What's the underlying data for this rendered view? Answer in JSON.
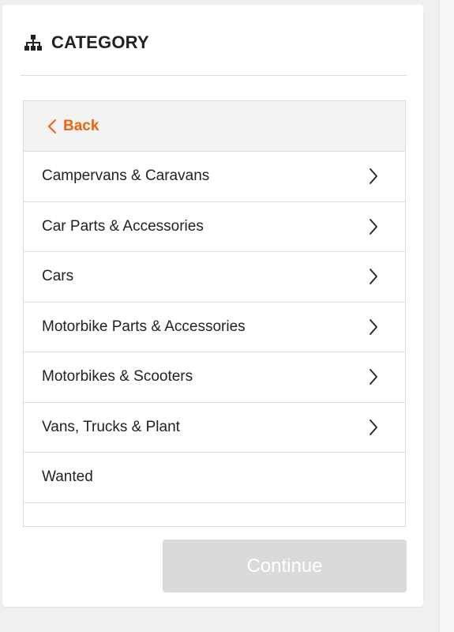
{
  "header": {
    "title": "CATEGORY",
    "icon": "sitemap-icon"
  },
  "back": {
    "label": "Back",
    "icon": "chevron-left-icon",
    "color": "#f0630c"
  },
  "categories": [
    {
      "label": "Campervans & Caravans",
      "has_children": true
    },
    {
      "label": "Car Parts & Accessories",
      "has_children": true
    },
    {
      "label": "Cars",
      "has_children": true
    },
    {
      "label": "Motorbike Parts & Accessories",
      "has_children": true
    },
    {
      "label": "Motorbikes & Scooters",
      "has_children": true
    },
    {
      "label": "Vans, Trucks & Plant",
      "has_children": true
    },
    {
      "label": "Wanted",
      "has_children": false
    },
    {
      "label": "",
      "has_children": false
    }
  ],
  "actions": {
    "continue_label": "Continue",
    "continue_enabled": false
  }
}
